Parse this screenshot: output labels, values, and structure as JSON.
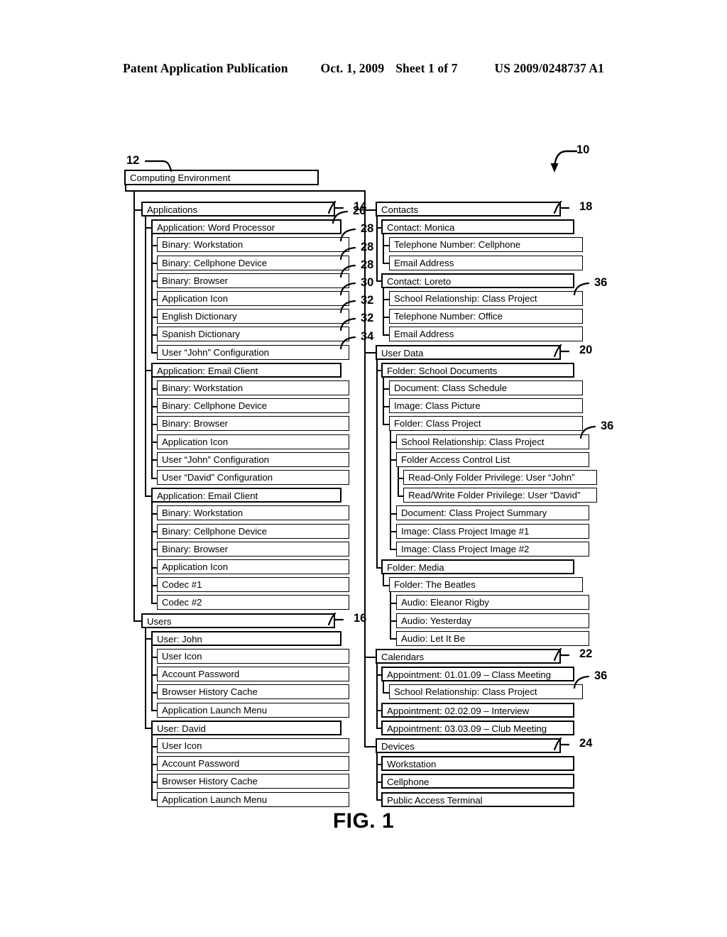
{
  "header": {
    "publication": "Patent Application Publication",
    "date": "Oct. 1, 2009",
    "sheet": "Sheet 1 of 7",
    "docnumber": "US 2009/0248737 A1"
  },
  "figure": {
    "caption": "FIG. 1",
    "overall_ref": "10"
  },
  "tree": {
    "root": {
      "label": "Computing Environment",
      "ref": "12"
    },
    "left_column": [
      {
        "label": "Applications",
        "ref": "14",
        "level": 1
      },
      {
        "label": "Application: Word Processor",
        "ref": "26",
        "level": 2
      },
      {
        "label": "Binary: Workstation",
        "ref": "28",
        "level": 3
      },
      {
        "label": "Binary: Cellphone Device",
        "ref": "28",
        "level": 3
      },
      {
        "label": "Binary: Browser",
        "ref": "28",
        "level": 3
      },
      {
        "label": "Application Icon",
        "ref": "30",
        "level": 3
      },
      {
        "label": "English Dictionary",
        "ref": "32",
        "level": 3
      },
      {
        "label": "Spanish Dictionary",
        "ref": "32",
        "level": 3
      },
      {
        "label": "User “John” Configuration",
        "ref": "34",
        "level": 3
      },
      {
        "label": "Application: Email Client",
        "ref": "",
        "level": 2
      },
      {
        "label": "Binary: Workstation",
        "ref": "",
        "level": 3
      },
      {
        "label": "Binary: Cellphone Device",
        "ref": "",
        "level": 3
      },
      {
        "label": "Binary: Browser",
        "ref": "",
        "level": 3
      },
      {
        "label": "Application Icon",
        "ref": "",
        "level": 3
      },
      {
        "label": "User “John” Configuration",
        "ref": "",
        "level": 3
      },
      {
        "label": "User “David” Configuration",
        "ref": "",
        "level": 3
      },
      {
        "label": "Application: Email Client",
        "ref": "",
        "level": 2
      },
      {
        "label": "Binary: Workstation",
        "ref": "",
        "level": 3
      },
      {
        "label": "Binary: Cellphone Device",
        "ref": "",
        "level": 3
      },
      {
        "label": "Binary: Browser",
        "ref": "",
        "level": 3
      },
      {
        "label": "Application Icon",
        "ref": "",
        "level": 3
      },
      {
        "label": "Codec #1",
        "ref": "",
        "level": 3
      },
      {
        "label": "Codec #2",
        "ref": "",
        "level": 3
      },
      {
        "label": "Users",
        "ref": "16",
        "level": 1
      },
      {
        "label": "User: John",
        "ref": "",
        "level": 2
      },
      {
        "label": "User Icon",
        "ref": "",
        "level": 3
      },
      {
        "label": "Account Password",
        "ref": "",
        "level": 3
      },
      {
        "label": "Browser History Cache",
        "ref": "",
        "level": 3
      },
      {
        "label": "Application Launch Menu",
        "ref": "",
        "level": 3
      },
      {
        "label": "User: David",
        "ref": "",
        "level": 2
      },
      {
        "label": "User Icon",
        "ref": "",
        "level": 3
      },
      {
        "label": "Account Password",
        "ref": "",
        "level": 3
      },
      {
        "label": "Browser History Cache",
        "ref": "",
        "level": 3
      },
      {
        "label": "Application Launch Menu",
        "ref": "",
        "level": 3
      }
    ],
    "right_column": [
      {
        "label": "Contacts",
        "ref": "18",
        "level": 1
      },
      {
        "label": "Contact: Monica",
        "ref": "",
        "level": 2
      },
      {
        "label": "Telephone Number: Cellphone",
        "ref": "",
        "level": 3
      },
      {
        "label": "Email Address",
        "ref": "",
        "level": 3
      },
      {
        "label": "Contact: Loreto",
        "ref": "",
        "level": 2
      },
      {
        "label": "School Relationship: Class Project",
        "ref": "36",
        "level": 3
      },
      {
        "label": "Telephone Number: Office",
        "ref": "",
        "level": 3
      },
      {
        "label": "Email Address",
        "ref": "",
        "level": 3
      },
      {
        "label": "User Data",
        "ref": "20",
        "level": 1
      },
      {
        "label": "Folder: School Documents",
        "ref": "",
        "level": 2
      },
      {
        "label": "Document: Class Schedule",
        "ref": "",
        "level": 3
      },
      {
        "label": "Image: Class Picture",
        "ref": "",
        "level": 3
      },
      {
        "label": "Folder: Class Project",
        "ref": "",
        "level": 3
      },
      {
        "label": "School Relationship: Class Project",
        "ref": "36",
        "level": 4
      },
      {
        "label": "Folder Access Control List",
        "ref": "",
        "level": 4
      },
      {
        "label": "Read-Only Folder Privilege: User “John”",
        "ref": "",
        "level": 5
      },
      {
        "label": "Read/Write Folder Privilege: User “David”",
        "ref": "",
        "level": 5
      },
      {
        "label": "Document: Class Project Summary",
        "ref": "",
        "level": 4
      },
      {
        "label": "Image: Class Project Image #1",
        "ref": "",
        "level": 4
      },
      {
        "label": "Image: Class Project Image #2",
        "ref": "",
        "level": 4
      },
      {
        "label": "Folder: Media",
        "ref": "",
        "level": 2
      },
      {
        "label": "Folder: The Beatles",
        "ref": "",
        "level": 3
      },
      {
        "label": "Audio: Eleanor Rigby",
        "ref": "",
        "level": 4
      },
      {
        "label": "Audio: Yesterday",
        "ref": "",
        "level": 4
      },
      {
        "label": "Audio: Let It Be",
        "ref": "",
        "level": 4
      },
      {
        "label": "Calendars",
        "ref": "22",
        "level": 1
      },
      {
        "label": "Appointment: 01.01.09 – Class Meeting",
        "ref": "",
        "level": 2
      },
      {
        "label": "School Relationship: Class Project",
        "ref": "36",
        "level": 3
      },
      {
        "label": "Appointment: 02.02.09 – Interview",
        "ref": "",
        "level": 2
      },
      {
        "label": "Appointment: 03.03.09 – Club Meeting",
        "ref": "",
        "level": 2
      },
      {
        "label": "Devices",
        "ref": "24",
        "level": 1
      },
      {
        "label": "Workstation",
        "ref": "",
        "level": 2
      },
      {
        "label": "Cellphone",
        "ref": "",
        "level": 2
      },
      {
        "label": "Public Access Terminal",
        "ref": "",
        "level": 2
      }
    ]
  }
}
